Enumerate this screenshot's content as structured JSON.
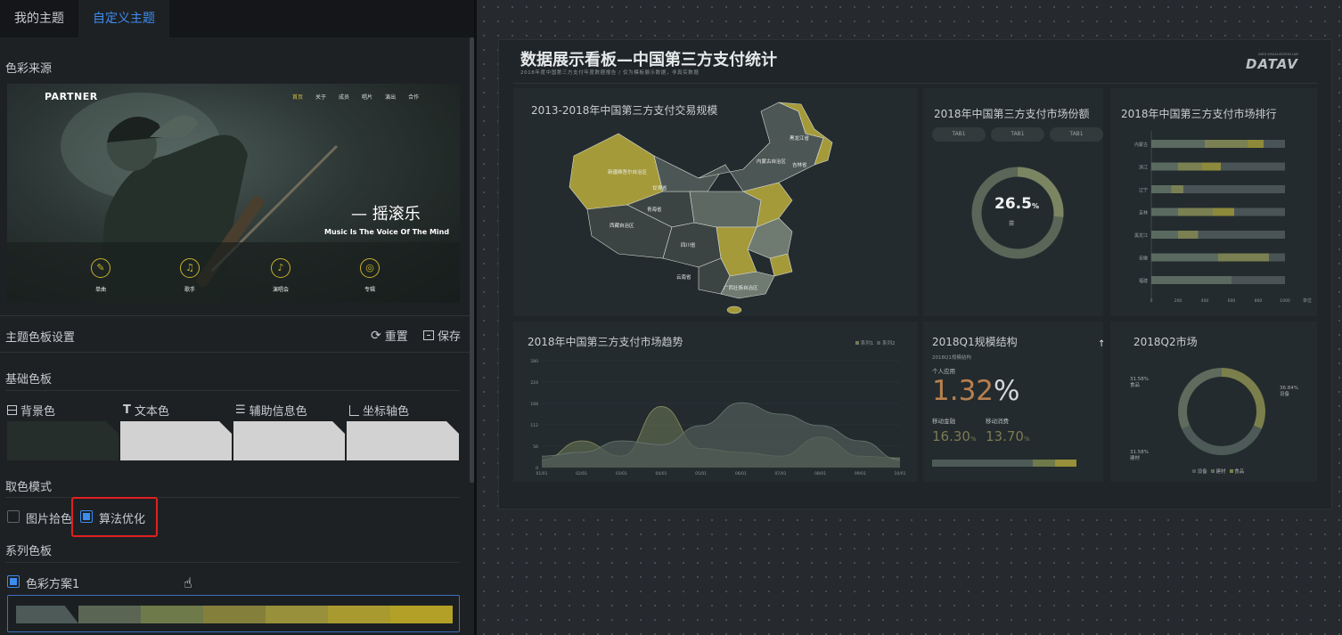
{
  "tabs": [
    "我的主题",
    "自定义主题"
  ],
  "sections": {
    "color_source": "色彩来源",
    "palette_settings": "主题色板设置",
    "base_palette": "基础色板",
    "pick_mode": "取色模式",
    "series_palette": "系列色板"
  },
  "actions": {
    "reset": "重置",
    "save": "保存"
  },
  "base_colors": [
    {
      "label": "背景色",
      "icon": "bg-layout-icon",
      "color": "#262e2b"
    },
    {
      "label": "文本色",
      "icon": "text-icon",
      "color": "#d2d2d2"
    },
    {
      "label": "辅助信息色",
      "icon": "list-icon",
      "color": "#d2d2d2"
    },
    {
      "label": "坐标轴色",
      "icon": "axis-icon",
      "color": "#d2d2d2"
    }
  ],
  "pick_modes": [
    {
      "label": "图片拾色",
      "checked": false
    },
    {
      "label": "算法优化",
      "checked": true
    }
  ],
  "highlight_color": "#e02020",
  "series_scheme": {
    "label": "色彩方案1",
    "checked": true,
    "colors": [
      "#4d5a57",
      "#5a6653",
      "#6f7a4a",
      "#857f3c",
      "#98903a",
      "#a99a30",
      "#b3a027"
    ]
  },
  "preview": {
    "logo": "PARTNER",
    "nav": [
      "首页",
      "关于",
      "成员",
      "唱片",
      "演出",
      "合作"
    ],
    "headline": "— 摇滚乐",
    "tagline": "Music Is The Voice Of The Mind",
    "icons": [
      {
        "label": "单曲",
        "icon": "microphone-icon"
      },
      {
        "label": "歌手",
        "icon": "singer-icon"
      },
      {
        "label": "演唱会",
        "icon": "concert-icon"
      },
      {
        "label": "专辑",
        "icon": "album-icon"
      }
    ]
  },
  "dashboard": {
    "title": "数据展示看板—中国第三方支付统计",
    "subtitle": "2018年度中国第三方支付年度数据报告 / 仅为模板展示数据，非真实数据",
    "brand": "DATAV",
    "brand_small": "DATA VISUALIZATION LAB",
    "map": {
      "title": "2013-2018年中国第三方支付交易规模",
      "labels": [
        "新疆维吾尔自治区",
        "西藏自治区",
        "青海省",
        "甘肃省",
        "内蒙古自治区",
        "黑龙江省",
        "吉林省",
        "四川省",
        "云南省",
        "广西壮族自治区"
      ]
    },
    "share": {
      "title": "2018年中国第三方支付市场份额",
      "tabs": [
        "TAB1",
        "TAB1",
        "TAB1"
      ],
      "value": "26.5",
      "unit": "%",
      "sublabel": "☰"
    },
    "ranking": {
      "title": "2018年中国第三方支付市场排行",
      "categories": [
        "内蒙古",
        "浙江",
        "辽宁",
        "吉林",
        "黑龙江",
        "安徽",
        "福建"
      ],
      "x_ticks": [
        "0",
        "200",
        "400",
        "600",
        "800",
        "1000"
      ],
      "x_unit": "单位"
    },
    "trend": {
      "title": "2018年中国第三方支付市场趋势",
      "legend": [
        "系列1",
        "系列2"
      ],
      "y_ticks": [
        "280",
        "224",
        "168",
        "112",
        "56",
        "0"
      ],
      "x_ticks": [
        "01/01",
        "02/01",
        "03/01",
        "04/01",
        "05/01",
        "06/01",
        "07/01",
        "08/01",
        "09/01",
        "10/01"
      ]
    },
    "q1": {
      "title": "2018Q1规模结构",
      "subtitle": "2018Q1规模结构",
      "label": "个人应用",
      "big_value": "1.32",
      "big_unit": "%",
      "items": [
        {
          "label": "移动金融",
          "value": "16.30",
          "unit": "%"
        },
        {
          "label": "移动消费",
          "value": "13.70",
          "unit": "%"
        }
      ]
    },
    "q2": {
      "title": "2018Q2市场",
      "labels": [
        {
          "pct": "31.58%",
          "name": "食品"
        },
        {
          "pct": "36.84%",
          "name": "设备"
        },
        {
          "pct": "31.58%",
          "name": "建材"
        }
      ],
      "legend": [
        "设备",
        "建材",
        "食品"
      ]
    }
  },
  "chart_data": [
    {
      "type": "bar",
      "title": "2018年中国第三方支付市场排行",
      "categories": [
        "内蒙古",
        "浙江",
        "辽宁",
        "吉林",
        "黑龙江",
        "安徽",
        "福建"
      ],
      "xlim": [
        0,
        1000
      ],
      "series": [
        {
          "values": [
            400,
            200,
            150,
            200,
            200,
            500,
            600
          ]
        },
        {
          "values": [
            320,
            180,
            90,
            260,
            150,
            380,
            0
          ]
        },
        {
          "values": [
            120,
            140,
            0,
            160,
            0,
            0,
            0
          ]
        }
      ],
      "totals": [
        1000,
        1000,
        1000,
        1000,
        1000,
        1000,
        1000
      ]
    },
    {
      "type": "area",
      "title": "2018年中国第三方支付市场趋势",
      "ylim": [
        0,
        280
      ],
      "x": [
        "01/01",
        "02/01",
        "03/01",
        "04/01",
        "05/01",
        "06/01",
        "07/01",
        "08/01",
        "09/01",
        "10/01"
      ],
      "series": [
        {
          "name": "系列1",
          "values": [
            20,
            70,
            30,
            160,
            50,
            40,
            30,
            80,
            30,
            25
          ]
        },
        {
          "name": "系列2",
          "values": [
            30,
            40,
            70,
            60,
            110,
            170,
            140,
            110,
            70,
            20
          ]
        }
      ]
    },
    {
      "type": "pie",
      "title": "2018Q2市场",
      "categories": [
        "食品",
        "设备",
        "建材"
      ],
      "values": [
        31.58,
        36.84,
        31.58
      ]
    },
    {
      "type": "pie",
      "title": "2018年中国第三方支付市场份额",
      "categories": [
        "份额"
      ],
      "values": [
        26.5
      ]
    }
  ]
}
